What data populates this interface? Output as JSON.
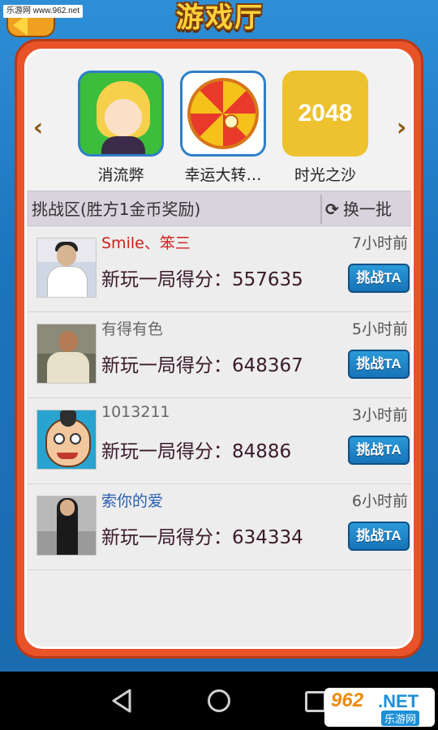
{
  "watermark_top": "乐游网 www.962.net",
  "header": {
    "title": "游戏厅"
  },
  "games": [
    {
      "name": "消流弊",
      "icon": "cartoon-girl"
    },
    {
      "name": "幸运大转…",
      "icon": "lucky-wheel"
    },
    {
      "name": "时光之沙",
      "icon": "2048-tile",
      "icon_text": "2048"
    }
  ],
  "carousel": {
    "prev": "‹",
    "next": "›"
  },
  "challenge": {
    "title": "挑战区(胜方1金币奖励)",
    "refresh_label": "换一批"
  },
  "rows": [
    {
      "username": "Smile、笨三",
      "username_color": "#d0201c",
      "time": "7小时前",
      "score": "新玩一局得分：557635",
      "button": "挑战TA"
    },
    {
      "username": "有得有色",
      "username_color": "#666666",
      "time": "5小时前",
      "score": "新玩一局得分：648367",
      "button": "挑战TA"
    },
    {
      "username": "1013211",
      "username_color": "#666666",
      "time": "3小时前",
      "score": "新玩一局得分：84886",
      "button": "挑战TA"
    },
    {
      "username": "索你的爱",
      "username_color": "#2a5fb0",
      "time": "6小时前",
      "score": "新玩一局得分：634334",
      "button": "挑战TA"
    }
  ],
  "watermark_bottom": {
    "number": "962",
    "net": ".NET",
    "cn": "乐游网"
  },
  "colors": {
    "frame": "#e8532a",
    "accent_blue": "#1c74bd",
    "button_blue": "#1773b8"
  }
}
